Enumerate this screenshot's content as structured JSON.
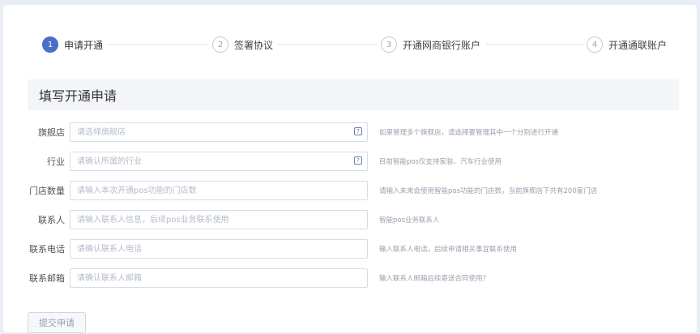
{
  "stepper": {
    "steps": [
      {
        "num": "1",
        "label": "申请开通",
        "active": true
      },
      {
        "num": "2",
        "label": "签署协议",
        "active": false
      },
      {
        "num": "3",
        "label": "开通网商银行账户",
        "active": false
      },
      {
        "num": "4",
        "label": "开通通联账户",
        "active": false
      }
    ]
  },
  "section": {
    "title": "填写开通申请"
  },
  "form": {
    "fields": [
      {
        "label": "旗舰店",
        "placeholder": "请选择旗舰店",
        "value": "",
        "type": "select",
        "hint": "如果管理多个旗舰店，请选择要管理其中一个分别进行开通"
      },
      {
        "label": "行业",
        "placeholder": "请确认所属的行业",
        "value": "",
        "type": "select",
        "hint": "目前智能pos仅支持家装、汽车行业使用"
      },
      {
        "label": "门店数量",
        "placeholder": "请输入本次开通pos功能的门店数",
        "value": "",
        "type": "text",
        "hint": "请输入未来会使用智能pos功能的门店数，当前旗舰店下共有200家门店"
      },
      {
        "label": "联系人",
        "placeholder": "请输入联系人信息，后续pos业务联系使用",
        "value": "",
        "type": "text",
        "hint": "智能pos业务联系人"
      },
      {
        "label": "联系电话",
        "placeholder": "请确认联系人电话",
        "value": "",
        "type": "text",
        "hint": "输入联系人电话，后续申请相关事宜联系使用"
      },
      {
        "label": "联系邮箱",
        "placeholder": "请确认联系人邮箱",
        "value": "",
        "type": "text",
        "hint": "输入联系人邮箱后续寄送合同使用？"
      }
    ],
    "dropdown_glyph": "?",
    "submit_label": "提交申请"
  },
  "colors": {
    "accent": "#4a6fc9",
    "background": "#e9edf5",
    "card": "#ffffff"
  }
}
